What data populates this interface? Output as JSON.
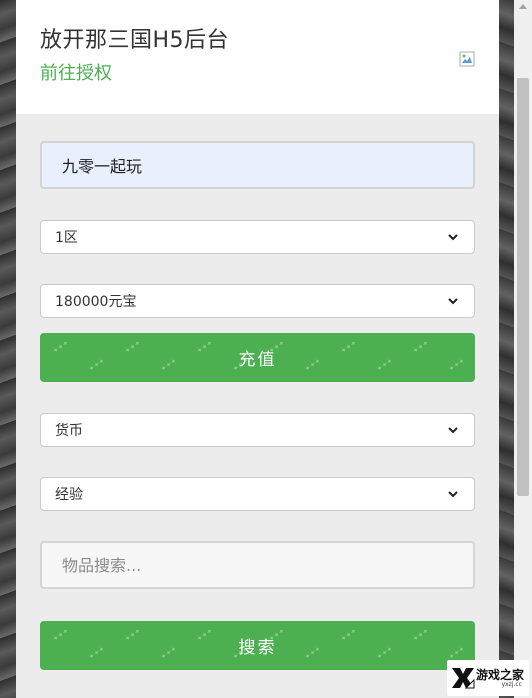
{
  "header": {
    "title": "放开那三国H5后台",
    "authorize_link": "前往授权"
  },
  "form": {
    "account_value": "九零一起玩",
    "server_select": "1区",
    "amount_select": "180000元宝",
    "recharge_button": "充值",
    "category_select": "货币",
    "type_select": "经验",
    "search_placeholder": "物品搜索...",
    "search_button": "搜索"
  },
  "watermark": {
    "text": "游戏之家",
    "sub": "yxzj.cc"
  },
  "colors": {
    "accent": "#4caf50",
    "input_fill": "#e8f0fe"
  }
}
